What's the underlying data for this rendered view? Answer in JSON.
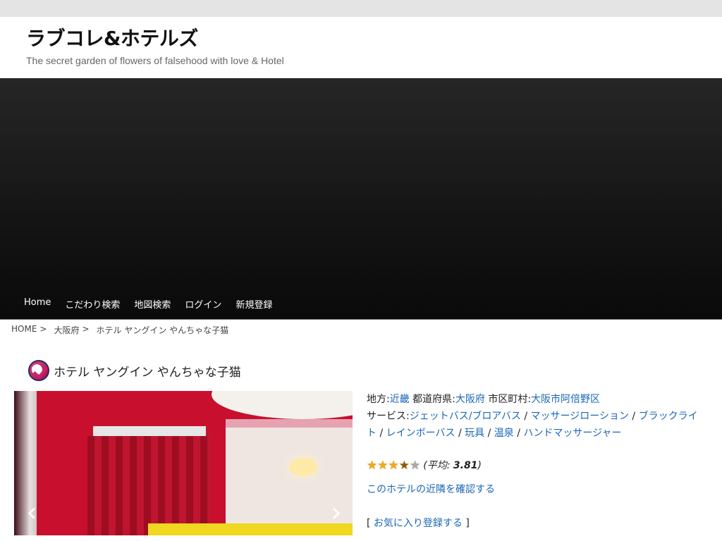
{
  "site": {
    "title": "ラブコレ&ホテルズ",
    "tagline": "The secret garden of flowers of falsehood with love & Hotel"
  },
  "nav": [
    "Home",
    "こだわり検索",
    "地図検索",
    "ログイン",
    "新規登録"
  ],
  "breadcrumb": [
    "HOME",
    ">",
    "大阪府",
    ">",
    "ホテル ヤングイン やんちゃな子猫"
  ],
  "hotel": {
    "name": "ホテル ヤングイン やんちゃな子猫",
    "region_label": "地方:",
    "region": "近畿",
    "prefecture_label": "都道府県:",
    "prefecture": "大阪府",
    "city_label": "市区町村:",
    "city": "大阪市阿倍野区",
    "services_label": "サービス:",
    "services": [
      "ジェットバス/ブロアバス",
      "マッサージローション",
      "ブラックライト",
      "レインボーバス",
      "玩具",
      "温泉",
      "ハンドマッサージャー"
    ],
    "service_sep": "/",
    "rating": {
      "value": 3.81,
      "max": 5,
      "prefix": "(",
      "label": "平均:",
      "value_text": "3.81",
      "suffix": ")"
    },
    "nearby_link": "このホテルの近隣を確認する",
    "fav_open": "[",
    "fav_link": "お気に入り登録する",
    "fav_close": "]"
  },
  "slider": {
    "prev_icon": "‹",
    "next_icon": "›"
  },
  "colors": {
    "link": "#1a66b8",
    "star": "#f2a91a"
  }
}
